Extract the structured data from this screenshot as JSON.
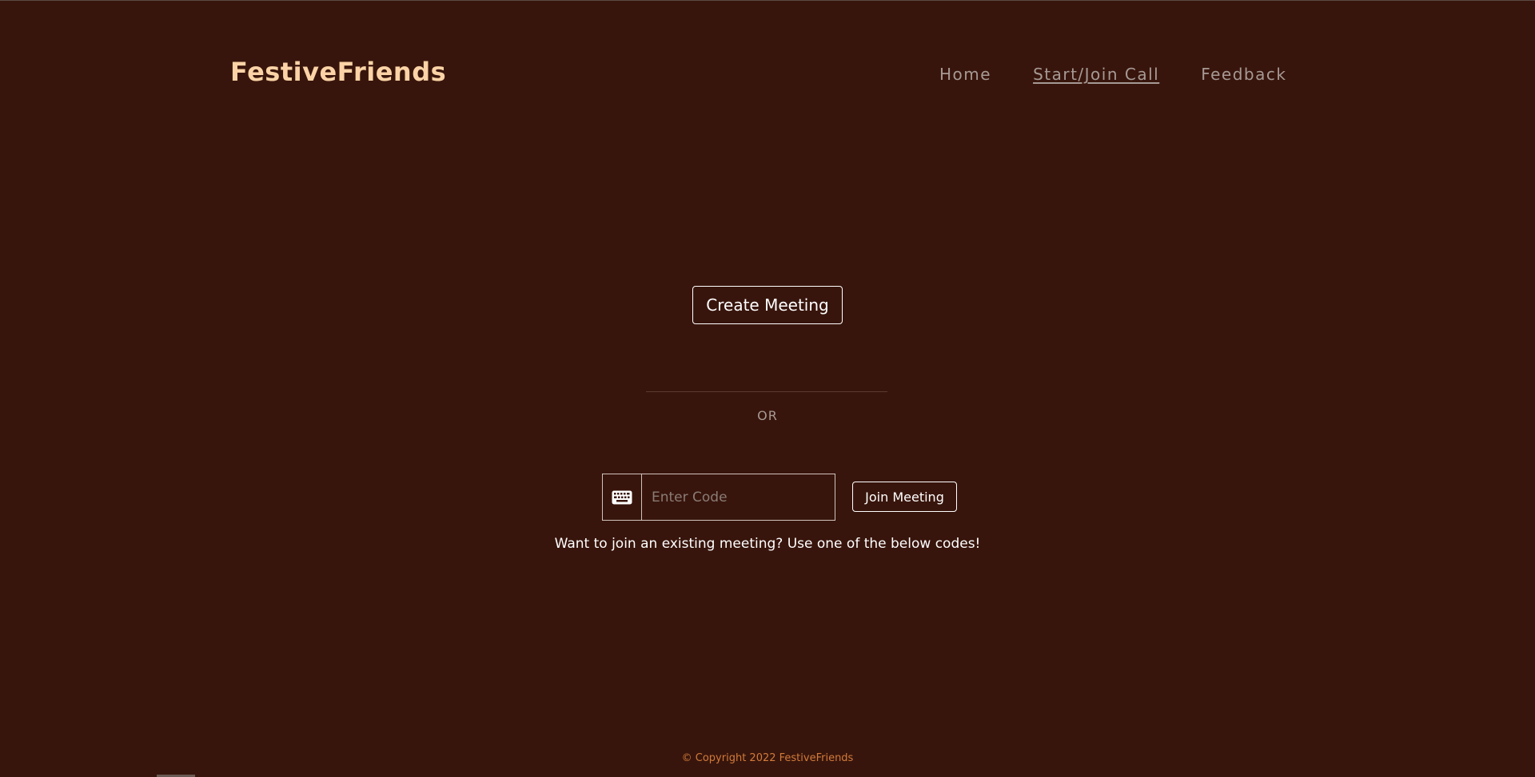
{
  "header": {
    "brand": "FestiveFriends",
    "nav": {
      "home": "Home",
      "start_join": "Start/Join Call",
      "feedback": "Feedback"
    }
  },
  "main": {
    "create_button": "Create Meeting",
    "or_label": "OR",
    "code_input": {
      "placeholder": "Enter Code",
      "value": "",
      "icon": "keyboard-icon"
    },
    "join_button": "Join Meeting",
    "hint": "Want to join an existing meeting? Use one of the below codes!"
  },
  "footer": {
    "copyright": "© Copyright 2022 FestiveFriends"
  },
  "colors": {
    "background": "#38150c",
    "brand": "#fbd3a6",
    "nav_text": "#a69994",
    "footer_text": "#d17b3a"
  }
}
